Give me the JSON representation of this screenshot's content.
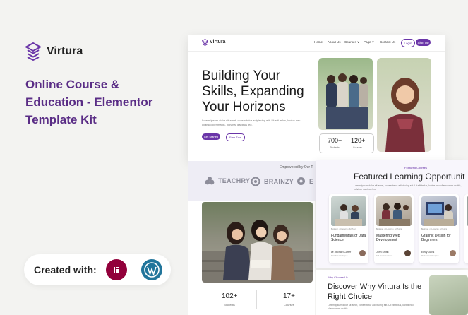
{
  "brand": {
    "name": "Virtura"
  },
  "kit_title": "Online Course & Education - Elementor Template Kit",
  "created": {
    "label": "Created with:"
  },
  "site": {
    "logo": "Virtura",
    "nav": [
      "Home",
      "About Us",
      "Courses ∨",
      "Page ∨",
      "Contact Us"
    ],
    "login": "Login",
    "signup": "Sign Up",
    "hero_title": "Building Your Skills, Expanding Your Horizons",
    "hero_text": "Lorem ipsum dolor sit amet, consectetur adipiscing elit. Ut elit tellus, luctus nec ullamcorper mattis, pulvinar dapibus leo.",
    "get_started": "Get Started",
    "free_trial": "Free Trial",
    "stats": [
      {
        "num": "700+",
        "label": "Students"
      },
      {
        "num": "120+",
        "label": "Courses"
      }
    ]
  },
  "partners": {
    "heading": "Empowered by Our T",
    "items": [
      "TEACHRY",
      "BRAINZY",
      "E"
    ]
  },
  "lower": {
    "stats": [
      {
        "num": "102+",
        "label": "Students"
      },
      {
        "num": "17+",
        "label": "Courses"
      }
    ]
  },
  "featured": {
    "eyebrow": "Featured Courses",
    "title": "Featured Learning Opportunit",
    "text": "Lorem ipsum dolor sit amet, consectetur adipiscing elit. Ut elit tellus, luctus nec ullamcorper mattis, pulvinar dapibus leo.",
    "cards": [
      {
        "meta": "Beginner  •  4 Lessons  •  32 Hours",
        "title": "Fundamentals of Data Science",
        "author": "Dr. Michael Carter",
        "role": "Data Scientist Expert"
      },
      {
        "meta": "Beginner  •  4 Lessons  •  32 Hours",
        "title": "Mastering Web Development",
        "author": "John Smith",
        "role": "Full Stack Developer"
      },
      {
        "meta": "Beginner  •  4 Lessons  •  32 Hours",
        "title": "Graphic Design for Beginners",
        "author": "Emily Davis",
        "role": "Professional Designer"
      }
    ]
  },
  "why": {
    "eyebrow": "Why Choose Us",
    "title": "Discover Why Virtura Is the Right Choice",
    "text": "Lorem ipsum dolor sit amet, consectetur adipiscing elit. Ut elit tellus, luctus nec ullamcorper mattis."
  },
  "colors": {
    "accent": "#6a35a8",
    "brand_title": "#5a2d86",
    "elementor": "#92003b",
    "wordpress": "#21759b"
  }
}
